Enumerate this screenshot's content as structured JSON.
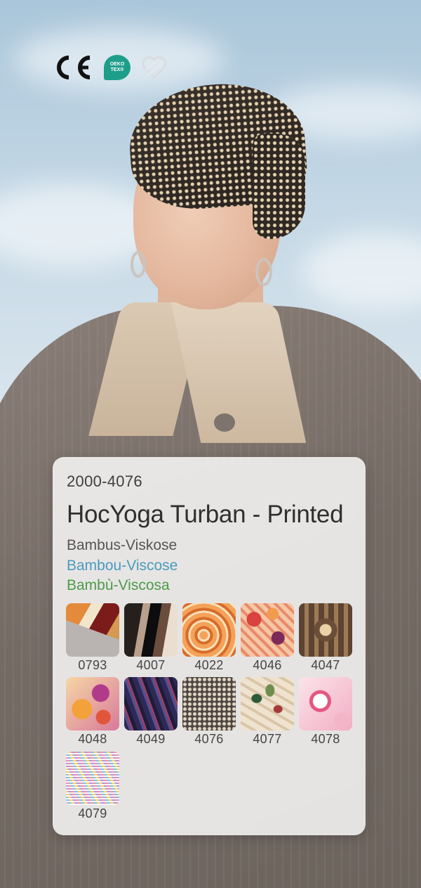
{
  "certifications": {
    "ce_label": "CE",
    "oeko_line1": "OEKO",
    "oeko_line2": "TEX®",
    "heart_logo": "heart-certification-icon",
    "oeko_color": "#1d9e8b"
  },
  "product": {
    "article_number": "2000-4076",
    "name": "HocYoga Turban - Printed",
    "material_de": "Bambus-Viskose",
    "material_fr": "Bambou-Viscose",
    "material_it": "Bambù-Viscosa",
    "colors": {
      "material_de": "#555555",
      "material_fr": "#4a9bbd",
      "material_it": "#4e9a49"
    }
  },
  "swatches": [
    {
      "code": "0793"
    },
    {
      "code": "4007"
    },
    {
      "code": "4022"
    },
    {
      "code": "4046"
    },
    {
      "code": "4047"
    },
    {
      "code": "4048"
    },
    {
      "code": "4049"
    },
    {
      "code": "4076"
    },
    {
      "code": "4077"
    },
    {
      "code": "4078"
    },
    {
      "code": "4079"
    }
  ]
}
